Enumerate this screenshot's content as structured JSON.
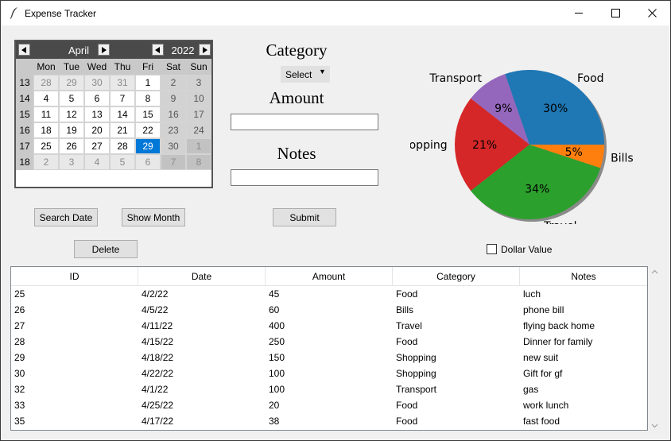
{
  "window": {
    "title": "Expense Tracker"
  },
  "calendar": {
    "month": "April",
    "year": "2022",
    "weekday_headers": [
      "Mon",
      "Tue",
      "Wed",
      "Thu",
      "Fri",
      "Sat",
      "Sun"
    ],
    "weeks": [
      {
        "week": "13",
        "days": [
          "28",
          "29",
          "30",
          "31",
          "1",
          "2",
          "3"
        ]
      },
      {
        "week": "14",
        "days": [
          "4",
          "5",
          "6",
          "7",
          "8",
          "9",
          "10"
        ]
      },
      {
        "week": "15",
        "days": [
          "11",
          "12",
          "13",
          "14",
          "15",
          "16",
          "17"
        ]
      },
      {
        "week": "16",
        "days": [
          "18",
          "19",
          "20",
          "21",
          "22",
          "23",
          "24"
        ]
      },
      {
        "week": "17",
        "days": [
          "25",
          "26",
          "27",
          "28",
          "29",
          "30",
          "1"
        ]
      },
      {
        "week": "18",
        "days": [
          "2",
          "3",
          "4",
          "5",
          "6",
          "7",
          "8"
        ]
      }
    ],
    "selected_day": "29",
    "selected_color": "#0078d7"
  },
  "form": {
    "category_label": "Category",
    "category_value": "Select",
    "amount_label": "Amount",
    "amount_value": "",
    "notes_label": "Notes",
    "notes_value": ""
  },
  "buttons": {
    "search_date": "Search Date",
    "show_month": "Show Month",
    "submit": "Submit",
    "delete": "Delete"
  },
  "dollar_value": {
    "label": "Dollar Value",
    "checked": false
  },
  "chart_data": {
    "type": "pie",
    "slices": [
      {
        "label": "Food",
        "value": 30,
        "pct_label": "30%",
        "color": "#1f77b4"
      },
      {
        "label": "Transport",
        "value": 9,
        "pct_label": "9%",
        "color": "#9467bd"
      },
      {
        "label": "Shopping",
        "value": 21,
        "pct_label": "21%",
        "color": "#d62728"
      },
      {
        "label": "Travel",
        "value": 34,
        "pct_label": "34%",
        "color": "#2ca02c"
      },
      {
        "label": "Bills",
        "value": 5,
        "pct_label": "5%",
        "color": "#ff7f0e"
      }
    ],
    "start_angle_deg": 0,
    "direction": "counterclockwise",
    "shadow": true
  },
  "table": {
    "columns": [
      "ID",
      "Date",
      "Amount",
      "Category",
      "Notes"
    ],
    "rows": [
      [
        "25",
        "4/2/22",
        "45",
        "Food",
        "luch"
      ],
      [
        "26",
        "4/5/22",
        "60",
        "Bills",
        "phone bill"
      ],
      [
        "27",
        "4/11/22",
        "400",
        "Travel",
        "flying back home"
      ],
      [
        "28",
        "4/15/22",
        "250",
        "Food",
        "Dinner for family"
      ],
      [
        "29",
        "4/18/22",
        "150",
        "Shopping",
        "new suit"
      ],
      [
        "30",
        "4/22/22",
        "100",
        "Shopping",
        "Gift for gf"
      ],
      [
        "32",
        "4/1/22",
        "100",
        "Transport",
        "gas"
      ],
      [
        "33",
        "4/25/22",
        "20",
        "Food",
        "work lunch"
      ],
      [
        "35",
        "4/17/22",
        "38",
        "Food",
        "fast food"
      ]
    ]
  }
}
